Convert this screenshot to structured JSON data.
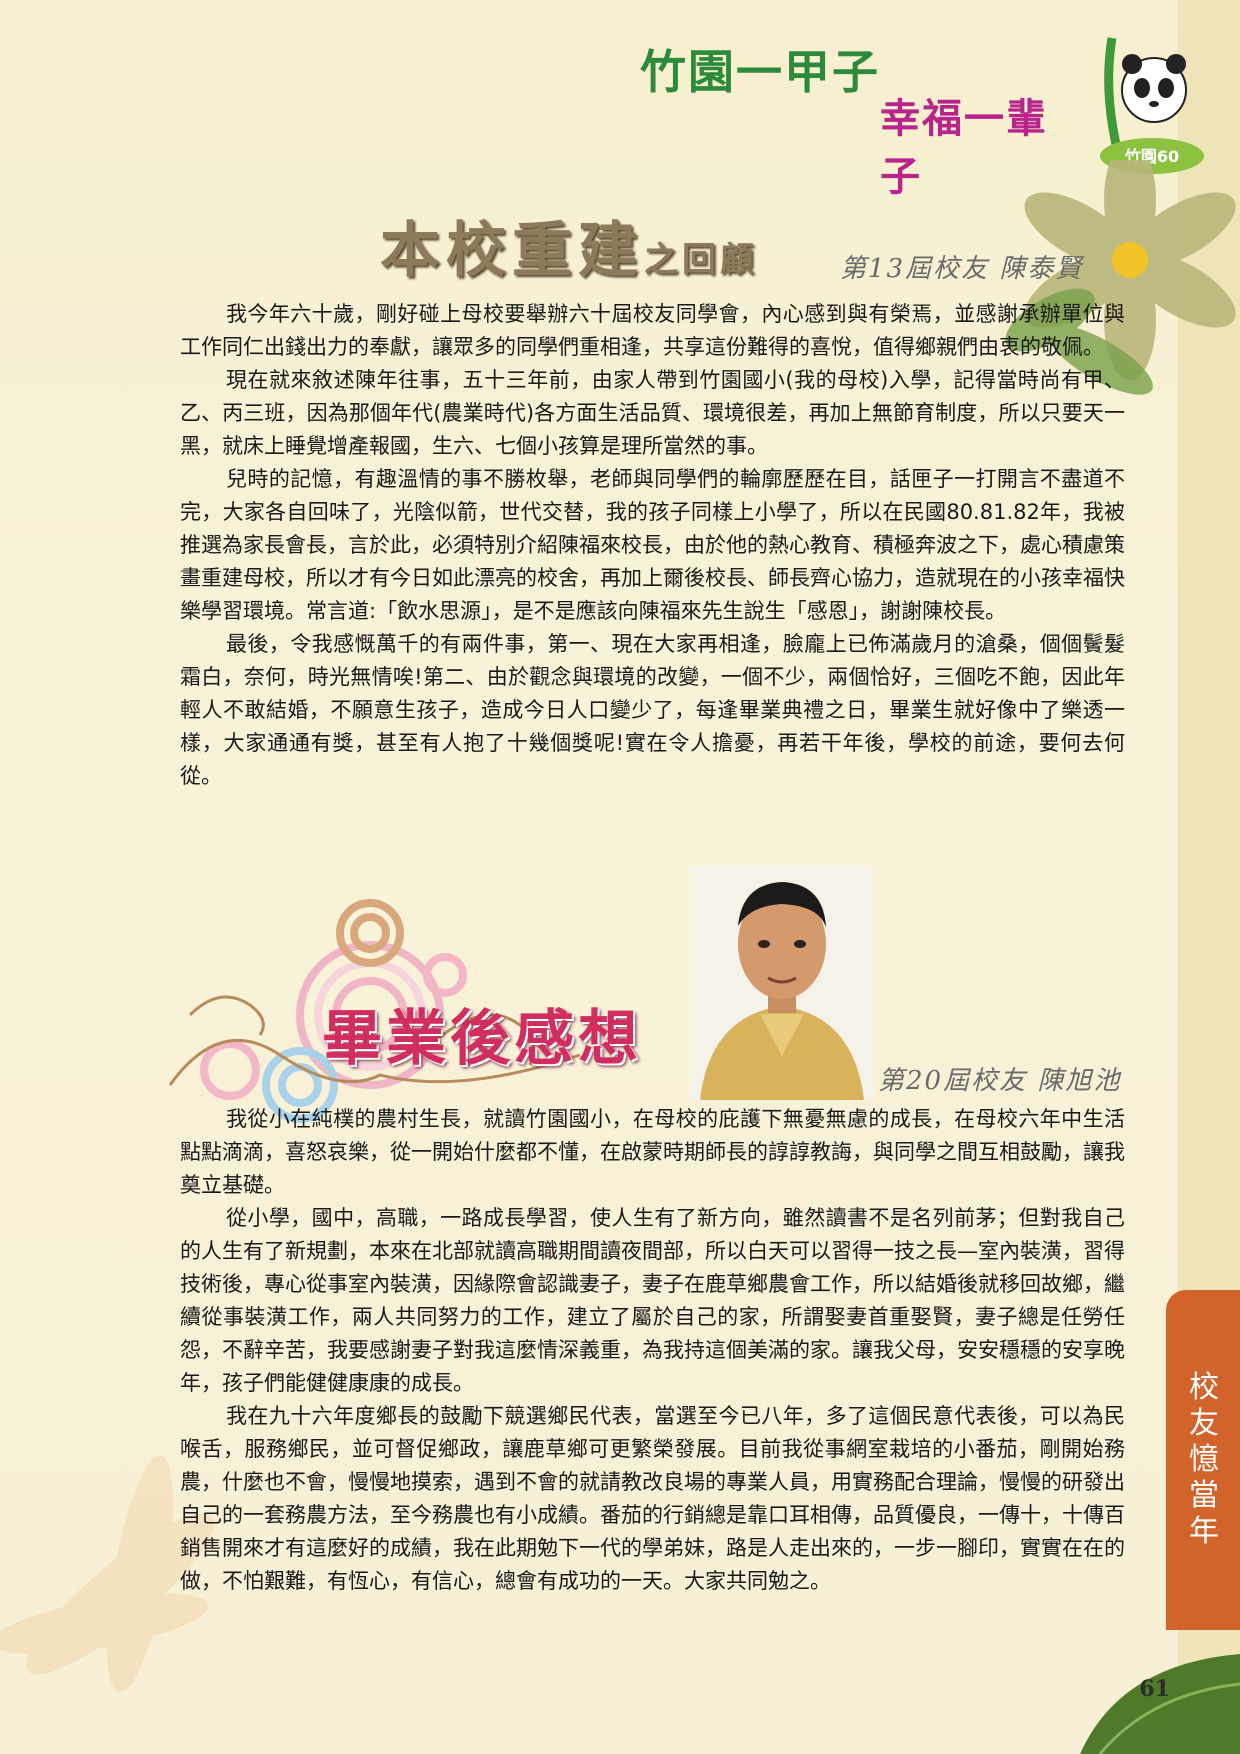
{
  "header": {
    "banner_line1": "竹園一甲子",
    "banner_line2": "幸福一輩子",
    "badge_text": "竹園60"
  },
  "article1": {
    "title": "本校重建",
    "title_suffix": "之回顧",
    "byline": "第13屆校友 陳泰賢",
    "paragraphs": [
      "我今年六十歲，剛好碰上母校要舉辦六十屆校友同學會，內心感到與有榮焉，並感謝承辦單位與工作同仁出錢出力的奉獻，讓眾多的同學們重相逢，共享這份難得的喜悅，值得鄉親們由衷的敬佩。",
      "現在就來敘述陳年往事，五十三年前，由家人帶到竹園國小(我的母校)入學，記得當時尚有甲、乙、丙三班，因為那個年代(農業時代)各方面生活品質、環境很差，再加上無節育制度，所以只要天一黑，就床上睡覺增產報國，生六、七個小孩算是理所當然的事。",
      "兒時的記憶，有趣溫情的事不勝枚舉，老師與同學們的輪廓歷歷在目，話匣子一打開言不盡道不完，大家各自回味了，光陰似箭，世代交替，我的孩子同樣上小學了，所以在民國80.81.82年，我被推選為家長會長，言於此，必須特別介紹陳福來校長，由於他的熱心教育、積極奔波之下，處心積慮策畫重建母校，所以才有今日如此漂亮的校舍，再加上爾後校長、師長齊心協力，造就現在的小孩幸福快樂學習環境。常言道:「飲水思源」，是不是應該向陳福來先生說生「感恩」，謝謝陳校長。",
      "最後，令我感慨萬千的有兩件事，第一、現在大家再相逢，臉龐上已佈滿歲月的滄桑，個個鬢髮霜白，奈何，時光無情唉!第二、由於觀念與環境的改變，一個不少，兩個恰好，三個吃不飽，因此年輕人不敢結婚，不願意生孩子，造成今日人口變少了，每逢畢業典禮之日，畢業生就好像中了樂透一樣，大家通通有獎，甚至有人抱了十幾個獎呢!實在令人擔憂，再若干年後，學校的前途，要何去何從。"
    ]
  },
  "article2": {
    "title": "畢業後感想",
    "byline": "第20屆校友 陳旭池",
    "paragraphs": [
      "我從小在純樸的農村生長，就讀竹園國小，在母校的庇護下無憂無慮的成長，在母校六年中生活點點滴滴，喜怒哀樂，從一開始什麼都不懂，在啟蒙時期師長的諄諄教誨，與同學之間互相鼓勵，讓我奠立基礎。",
      "從小學，國中，高職，一路成長學習，使人生有了新方向，雖然讀書不是名列前茅；但對我自己的人生有了新規劃，本來在北部就讀高職期間讀夜間部，所以白天可以習得一技之長—室內裝潢，習得技術後，專心從事室內裝潢，因緣際會認識妻子，妻子在鹿草鄉農會工作，所以結婚後就移回故鄉，繼續從事裝潢工作，兩人共同努力的工作，建立了屬於自己的家，所謂娶妻首重娶賢，妻子總是任勞任怨，不辭辛苦，我要感謝妻子對我這麼情深義重，為我持這個美滿的家。讓我父母，安安穩穩的安享晚年，孩子們能健健康康的成長。",
      "我在九十六年度鄉長的鼓勵下競選鄉民代表，當選至今已八年，多了這個民意代表後，可以為民喉舌，服務鄉民，並可督促鄉政，讓鹿草鄉可更繁榮發展。目前我從事網室栽培的小番茄，剛開始務農，什麼也不會，慢慢地摸索，遇到不會的就請教改良場的專業人員，用實務配合理論，慢慢的研發出自己的一套務農方法，至今務農也有小成績。番茄的行銷總是靠口耳相傳，品質優良，一傳十，十傳百銷售開來才有這麼好的成績，我在此期勉下一代的學弟妹，路是人走出來的，一步一腳印，實實在在的做，不怕艱難，有恆心，有信心，總會有成功的一天。大家共同勉之。"
    ]
  },
  "side_tab": {
    "label": "校友憶當年"
  },
  "footer": {
    "page_number": "61"
  },
  "colors": {
    "background": "#f7f0d6",
    "banner_green": "#2d8a3a",
    "banner_magenta": "#b8238c",
    "title2_pink": "#d12d5e",
    "side_tab_orange": "#d2632a"
  },
  "icons": [
    "panda-bamboo-logo",
    "flower-decoration",
    "swirl-circles-decoration",
    "leaf-decoration",
    "author-portrait-photo"
  ]
}
